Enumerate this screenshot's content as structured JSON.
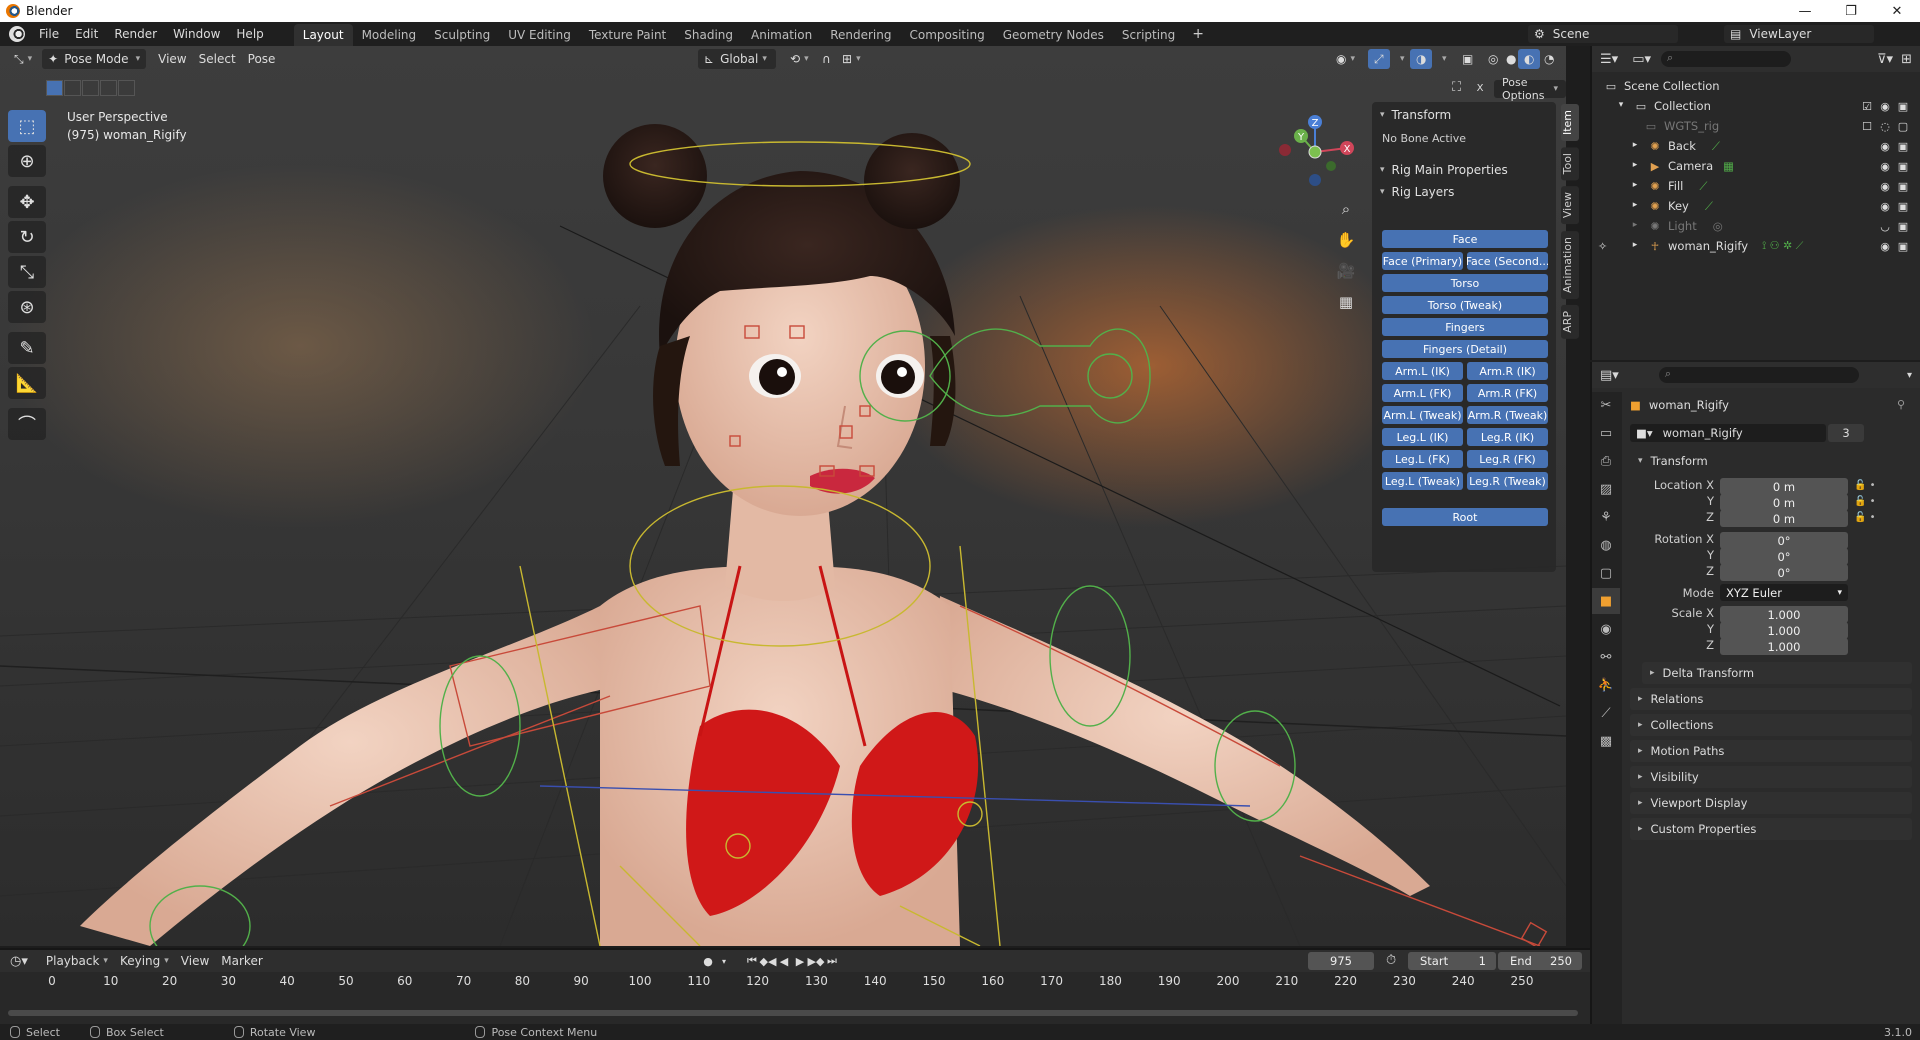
{
  "window": {
    "title": "Blender",
    "controls": [
      "—",
      "❐",
      "✕"
    ]
  },
  "menubar": {
    "items": [
      "File",
      "Edit",
      "Render",
      "Window",
      "Help"
    ]
  },
  "workspaces": {
    "tabs": [
      "Layout",
      "Modeling",
      "Sculpting",
      "UV Editing",
      "Texture Paint",
      "Shading",
      "Animation",
      "Rendering",
      "Compositing",
      "Geometry Nodes",
      "Scripting"
    ],
    "active": "Layout",
    "add": "+",
    "scene": "Scene",
    "view_layer": "ViewLayer"
  },
  "viewport": {
    "mode": "Pose Mode",
    "menus": [
      "View",
      "Select",
      "Pose"
    ],
    "orientation": "Global",
    "info_line1": "User Perspective",
    "info_line2": "(975) woman_Rigify",
    "pose_options": "Pose Options"
  },
  "gizmo": {
    "x": "X",
    "y": "Y",
    "z": "Z"
  },
  "npanel": {
    "transform_header": "Transform",
    "no_bone": "No Bone Active",
    "rig_main": "Rig Main Properties",
    "rig_layers": "Rig Layers",
    "buttons": {
      "face": "Face",
      "face_primary": "Face (Primary)",
      "face_secondary": "Face (Second...",
      "torso": "Torso",
      "torso_tweak": "Torso (Tweak)",
      "fingers": "Fingers",
      "fingers_detail": "Fingers (Detail)",
      "arm_l_ik": "Arm.L (IK)",
      "arm_r_ik": "Arm.R (IK)",
      "arm_l_fk": "Arm.L (FK)",
      "arm_r_fk": "Arm.R (FK)",
      "arm_l_tweak": "Arm.L (Tweak)",
      "arm_r_tweak": "Arm.R (Tweak)",
      "leg_l_ik": "Leg.L (IK)",
      "leg_r_ik": "Leg.R (IK)",
      "leg_l_fk": "Leg.L (FK)",
      "leg_r_fk": "Leg.R (FK)",
      "leg_l_tweak": "Leg.L (Tweak)",
      "leg_r_tweak": "Leg.R (Tweak)",
      "root": "Root"
    },
    "tabs": [
      "Item",
      "Tool",
      "View",
      "Animation",
      "ARP"
    ]
  },
  "outliner": {
    "scene_collection": "Scene Collection",
    "collection": "Collection",
    "items": [
      {
        "name": "WGTS_rig",
        "dim": true
      },
      {
        "name": "Back",
        "dim": false
      },
      {
        "name": "Camera",
        "dim": false
      },
      {
        "name": "Fill",
        "dim": false
      },
      {
        "name": "Key",
        "dim": false
      },
      {
        "name": "Light",
        "dim": true
      },
      {
        "name": "woman_Rigify",
        "dim": false
      }
    ]
  },
  "properties": {
    "object_name": "woman_Rigify",
    "data_name": "woman_Rigify",
    "users": "3",
    "transform": "Transform",
    "location_x_label": "Location X",
    "y_label": "Y",
    "z_label": "Z",
    "rotation_x_label": "Rotation X",
    "scale_x_label": "Scale X",
    "mode_label": "Mode",
    "location": [
      "0 m",
      "0 m",
      "0 m"
    ],
    "rotation": [
      "0°",
      "0°",
      "0°"
    ],
    "mode": "XYZ Euler",
    "scale": [
      "1.000",
      "1.000",
      "1.000"
    ],
    "delta_transform": "Delta Transform",
    "panels": [
      "Relations",
      "Collections",
      "Motion Paths",
      "Visibility",
      "Viewport Display",
      "Custom Properties"
    ]
  },
  "timeline": {
    "menus": [
      "Playback",
      "Keying",
      "View",
      "Marker"
    ],
    "current_frame": "975",
    "start_label": "Start",
    "start": "1",
    "end_label": "End",
    "end": "250",
    "ticks": [
      "0",
      "10",
      "20",
      "30",
      "40",
      "50",
      "60",
      "70",
      "80",
      "90",
      "100",
      "110",
      "120",
      "130",
      "140",
      "150",
      "160",
      "170",
      "180",
      "190",
      "200",
      "210",
      "220",
      "230",
      "240",
      "250"
    ]
  },
  "statusbar": {
    "select": "Select",
    "box_select": "Box Select",
    "rotate_view": "Rotate View",
    "context_menu": "Pose Context Menu",
    "version": "3.1.0"
  },
  "colors": {
    "accent": "#4772b3",
    "bikini": "#d01818",
    "skin": "#e9c0ac",
    "bone_yellow": "#c8b830",
    "bone_green": "#52b04a"
  }
}
